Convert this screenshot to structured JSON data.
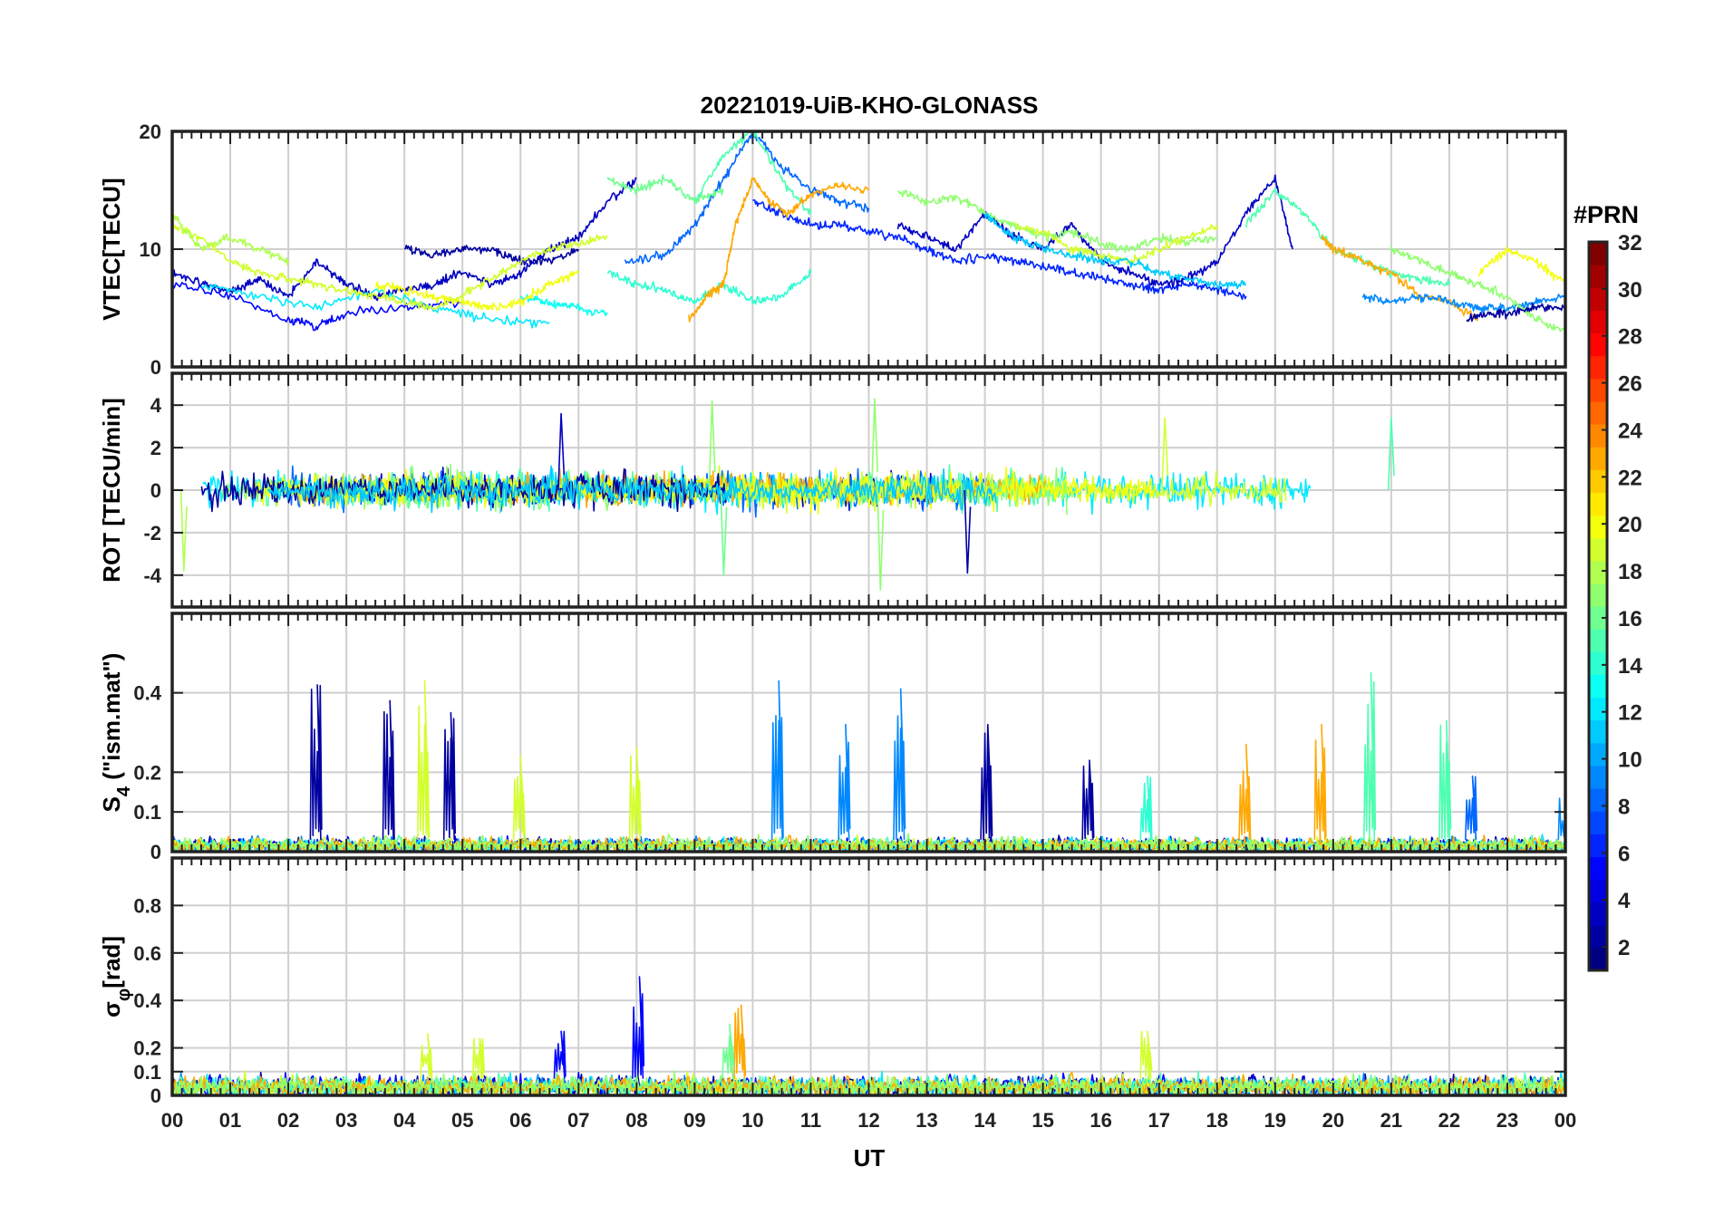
{
  "chart_data": {
    "type": "line",
    "title": "20221019-UiB-KHO-GLONASS",
    "xlabel": "UT",
    "xlim": [
      0,
      24
    ],
    "x_ticks": [
      "00",
      "01",
      "02",
      "03",
      "04",
      "05",
      "06",
      "07",
      "08",
      "09",
      "10",
      "11",
      "12",
      "13",
      "14",
      "15",
      "16",
      "17",
      "18",
      "19",
      "20",
      "21",
      "22",
      "23",
      "00"
    ],
    "grid": true,
    "colorbar": {
      "label": "#PRN",
      "range": [
        1,
        32
      ],
      "colormap": "jet",
      "ticks": [
        2,
        4,
        6,
        8,
        10,
        12,
        14,
        16,
        18,
        20,
        22,
        24,
        26,
        28,
        30,
        32
      ],
      "placement": "right"
    },
    "panels": [
      {
        "id": "vtec",
        "ylabel": "VTEC[TECU]",
        "ylim": [
          0,
          20
        ],
        "yticks": [
          0,
          10,
          20
        ],
        "series": [
          {
            "prn": 3,
            "x": [
              0.0,
              0.5,
              1.0,
              1.5,
              2.0,
              2.5,
              3.0,
              3.5,
              4.0,
              4.5,
              5.0,
              5.5,
              6.0,
              6.5,
              7.0,
              7.5,
              8.0
            ],
            "y": [
              8,
              7,
              6.5,
              7.5,
              6,
              9,
              7,
              6,
              6.5,
              7,
              8,
              7,
              8,
              10,
              11,
              14,
              16
            ]
          },
          {
            "prn": 5,
            "x": [
              0.0,
              1.0,
              2.0,
              2.5,
              3.0,
              4.0,
              5.0
            ],
            "y": [
              7,
              6,
              4,
              3.5,
              4.5,
              5,
              5.5
            ]
          },
          {
            "prn": 8,
            "x": [
              7.8,
              8.5,
              9.0,
              9.5,
              10.0,
              10.5,
              11.0,
              11.5,
              12.0
            ],
            "y": [
              9,
              9.5,
              12,
              16,
              20,
              17,
              15,
              14,
              13.5
            ]
          },
          {
            "prn": 6,
            "x": [
              10.0,
              10.5,
              11.0,
              11.5,
              12.0,
              12.5,
              13.0,
              13.5,
              14.0,
              14.5,
              15.0,
              15.5,
              16.0,
              16.5,
              17.0,
              17.5,
              18.0,
              18.5
            ],
            "y": [
              14,
              13,
              12,
              12,
              11.5,
              11,
              10,
              9,
              9.5,
              9,
              8.5,
              8,
              7.5,
              7,
              6.5,
              7,
              6.5,
              6
            ]
          },
          {
            "prn": 2,
            "x": [
              4.0,
              4.5,
              5.0,
              5.5,
              6.0,
              6.5,
              7.0
            ],
            "y": [
              10,
              9.5,
              10,
              10,
              9,
              9,
              10
            ]
          },
          {
            "prn": 3,
            "x": [
              12.5,
              13.0,
              13.5,
              14.0,
              14.5,
              15.0,
              15.5,
              16.0,
              16.5,
              17.0,
              17.5,
              18.0,
              18.5,
              19.0,
              19.3
            ],
            "y": [
              12,
              11,
              10,
              13,
              11,
              10,
              12,
              9,
              8,
              7,
              7.5,
              9,
              13,
              16,
              10
            ]
          },
          {
            "prn": 12,
            "x": [
              0.5,
              1.5,
              2.5,
              3.5,
              4.5,
              5.5,
              6.5
            ],
            "y": [
              7,
              6,
              5,
              6.5,
              5,
              4,
              3.8
            ]
          },
          {
            "prn": 13,
            "x": [
              6.0,
              6.5,
              7.0,
              7.5
            ],
            "y": [
              6,
              5.5,
              5,
              4.5
            ]
          },
          {
            "prn": 14,
            "x": [
              7.5,
              8.0,
              8.5,
              9.0,
              9.5,
              10.0,
              10.5,
              11.0
            ],
            "y": [
              8,
              7,
              6.5,
              5.5,
              7,
              5.5,
              6,
              8
            ]
          },
          {
            "prn": 15,
            "x": [
              9.0,
              9.5,
              10.0,
              10.5,
              11.0
            ],
            "y": [
              14,
              18,
              20,
              16,
              13
            ]
          },
          {
            "prn": 16,
            "x": [
              7.5,
              8.0,
              8.5,
              9.0,
              9.5
            ],
            "y": [
              16,
              15,
              16,
              14,
              15
            ]
          },
          {
            "prn": 23,
            "x": [
              8.9,
              9.2,
              9.5,
              9.7,
              10.0,
              10.3,
              10.6,
              11.0,
              11.5,
              12.0
            ],
            "y": [
              4,
              6,
              7,
              12,
              16,
              14,
              13,
              14.5,
              15.5,
              15
            ]
          },
          {
            "prn": 19,
            "x": [
              0.0,
              0.5,
              1.0,
              1.5,
              2.0,
              2.5,
              3.0,
              3.5,
              4.0,
              4.5,
              5.0,
              5.5,
              6.0,
              6.5,
              7.0,
              7.5
            ],
            "y": [
              12,
              11,
              9,
              8,
              7.5,
              7,
              6.5,
              6,
              5.5,
              5,
              6,
              7.5,
              9,
              10,
              10.5,
              11
            ]
          },
          {
            "prn": 18,
            "x": [
              0.0,
              0.5,
              1.0,
              1.5,
              2.0
            ],
            "y": [
              13,
              10,
              11,
              10,
              9
            ]
          },
          {
            "prn": 20,
            "x": [
              3.5,
              4.0,
              4.5,
              5.0,
              5.5,
              6.0,
              6.5,
              7.0
            ],
            "y": [
              7,
              6.5,
              6,
              5.5,
              5,
              5.5,
              7,
              8
            ]
          },
          {
            "prn": 17,
            "x": [
              12.5,
              13.0,
              13.5,
              14.0,
              14.5,
              15.0,
              15.5,
              16.0,
              16.5,
              17.0,
              17.5,
              18.0
            ],
            "y": [
              15,
              14,
              14.5,
              13,
              12,
              11,
              11.5,
              10.5,
              10,
              11,
              10.5,
              11
            ]
          },
          {
            "prn": 19,
            "x": [
              14.5,
              15.0,
              15.5,
              16.0,
              16.5,
              17.0,
              17.5,
              18.0
            ],
            "y": [
              12,
              11.5,
              10,
              9.5,
              9,
              10,
              11,
              12
            ]
          },
          {
            "prn": 11,
            "x": [
              14.0,
              14.5,
              15.0,
              15.5,
              16.0,
              16.5,
              17.0,
              17.5,
              18.0,
              18.5
            ],
            "y": [
              13,
              11,
              10,
              9.5,
              9,
              9,
              8,
              7.5,
              7,
              7
            ]
          },
          {
            "prn": 15,
            "x": [
              18.5,
              19.0,
              19.5,
              20.0,
              20.5,
              21.0,
              21.5,
              22.0
            ],
            "y": [
              12,
              15,
              13,
              10,
              9,
              8,
              7.5,
              7
            ]
          },
          {
            "prn": 23,
            "x": [
              19.8,
              20.0,
              20.5,
              21.0,
              21.5,
              22.0,
              22.5
            ],
            "y": [
              11,
              10,
              9,
              8,
              6,
              5.5,
              4
            ]
          },
          {
            "prn": 9,
            "x": [
              20.5,
              21.0,
              21.5,
              22.0,
              22.5,
              23.0,
              23.5,
              24.0
            ],
            "y": [
              6,
              5.5,
              6,
              5.5,
              5,
              5,
              5.5,
              6
            ]
          },
          {
            "prn": 17,
            "x": [
              21.0,
              21.5,
              22.0,
              22.5,
              23.0,
              23.5,
              24.0
            ],
            "y": [
              10,
              9,
              8,
              7,
              6,
              4,
              3
            ]
          },
          {
            "prn": 20,
            "x": [
              22.5,
              23.0,
              23.5,
              24.0
            ],
            "y": [
              8,
              10,
              9,
              7
            ]
          },
          {
            "prn": 2,
            "x": [
              22.3,
              22.6,
              23.0,
              23.5,
              24.0
            ],
            "y": [
              4,
              4.5,
              4.5,
              5,
              5
            ]
          }
        ]
      },
      {
        "id": "rot",
        "ylabel": "ROT [TECU/min]",
        "ylim": [
          -5.5,
          5.5
        ],
        "yticks": [
          -4,
          -2,
          0,
          2,
          4
        ],
        "series_prns": [
          3,
          8,
          12,
          15,
          19,
          23,
          17,
          20,
          2,
          11
        ],
        "extremes": [
          {
            "prn": 3,
            "x": 6.7,
            "y": 3.6
          },
          {
            "prn": 17,
            "x": 9.3,
            "y": 4.2
          },
          {
            "prn": 17,
            "x": 12.1,
            "y": 4.3
          },
          {
            "prn": 17,
            "x": 12.2,
            "y": -4.7
          },
          {
            "prn": 2,
            "x": 13.7,
            "y": -3.9
          },
          {
            "prn": 19,
            "x": 17.1,
            "y": 3.4
          },
          {
            "prn": 15,
            "x": 21.0,
            "y": 3.4
          },
          {
            "prn": 16,
            "x": 9.5,
            "y": -4.0
          },
          {
            "prn": 18,
            "x": 0.2,
            "y": -3.8
          }
        ]
      },
      {
        "id": "s4",
        "ylabel": "S_4 (\"ism.mat\")",
        "ylabel_main": "S",
        "ylabel_sub": "4",
        "ylabel_tail": " (\"ism.mat\")",
        "ylim": [
          0,
          0.6
        ],
        "yticks": [
          0,
          0.1,
          0.2,
          0.4
        ],
        "baseline": 0.03,
        "spikes": [
          {
            "prn": 2,
            "x": 2.5,
            "y": 0.42
          },
          {
            "prn": 2,
            "x": 3.75,
            "y": 0.38
          },
          {
            "prn": 19,
            "x": 4.35,
            "y": 0.43
          },
          {
            "prn": 2,
            "x": 4.8,
            "y": 0.35
          },
          {
            "prn": 19,
            "x": 6.0,
            "y": 0.24
          },
          {
            "prn": 19,
            "x": 8.0,
            "y": 0.26
          },
          {
            "prn": 9,
            "x": 10.45,
            "y": 0.43
          },
          {
            "prn": 9,
            "x": 11.6,
            "y": 0.32
          },
          {
            "prn": 9,
            "x": 12.55,
            "y": 0.41
          },
          {
            "prn": 2,
            "x": 14.05,
            "y": 0.32
          },
          {
            "prn": 2,
            "x": 15.8,
            "y": 0.23
          },
          {
            "prn": 14,
            "x": 16.8,
            "y": 0.19
          },
          {
            "prn": 23,
            "x": 18.5,
            "y": 0.27
          },
          {
            "prn": 23,
            "x": 19.8,
            "y": 0.32
          },
          {
            "prn": 15,
            "x": 20.65,
            "y": 0.45
          },
          {
            "prn": 15,
            "x": 21.95,
            "y": 0.33
          },
          {
            "prn": 8,
            "x": 22.4,
            "y": 0.19
          },
          {
            "prn": 9,
            "x": 24.0,
            "y": 0.14
          }
        ]
      },
      {
        "id": "sigma",
        "ylabel": "σφ[rad]",
        "ylabel_main": "σ",
        "ylabel_sub": "φ",
        "ylabel_tail": "[rad]",
        "ylim": [
          0,
          1
        ],
        "yticks": [
          0,
          0.1,
          0.2,
          0.4,
          0.6,
          0.8
        ],
        "baseline": 0.07,
        "spikes": [
          {
            "prn": 5,
            "x": 6.7,
            "y": 0.27
          },
          {
            "prn": 5,
            "x": 8.05,
            "y": 0.5
          },
          {
            "prn": 23,
            "x": 9.8,
            "y": 0.38
          },
          {
            "prn": 16,
            "x": 9.6,
            "y": 0.3
          },
          {
            "prn": 19,
            "x": 4.4,
            "y": 0.26
          },
          {
            "prn": 19,
            "x": 5.3,
            "y": 0.24
          },
          {
            "prn": 19,
            "x": 16.8,
            "y": 0.27
          }
        ]
      }
    ]
  }
}
